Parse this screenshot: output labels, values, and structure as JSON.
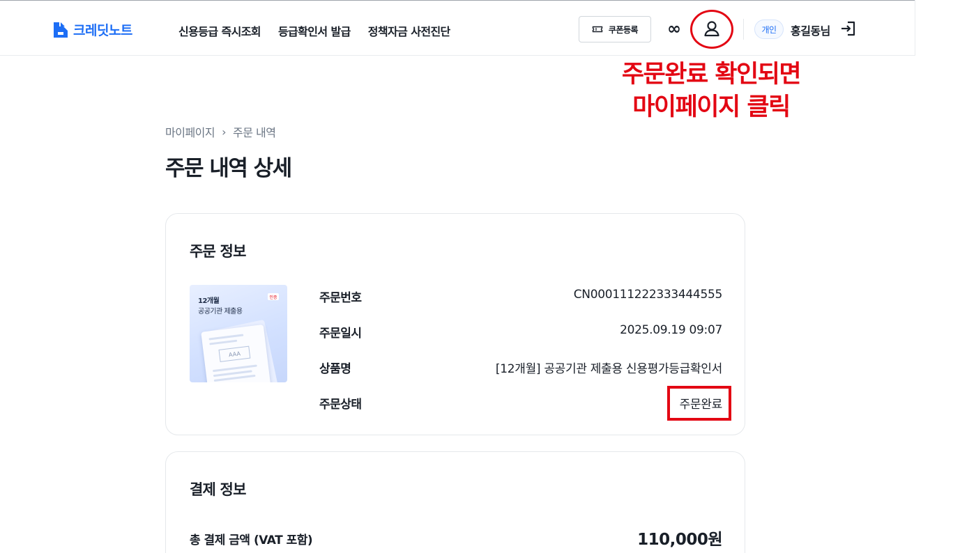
{
  "header": {
    "logo_text": "크레딧노트",
    "nav": [
      "신용등급 즉시조회",
      "등급확인서 발급",
      "정책자금 사전진단"
    ],
    "coupon_label": "쿠폰등록",
    "infinity_symbol": "∞",
    "account_type_badge": "개인",
    "username": "홍길동님"
  },
  "annotation": {
    "line1": "주문완료 확인되면",
    "line2": "마이페이지 클릭"
  },
  "breadcrumb": {
    "items": [
      "마이페이지",
      "주문 내역"
    ],
    "separator": "›"
  },
  "page_title": "주문 내역 상세",
  "order_info": {
    "title": "주문 정보",
    "thumbnail": {
      "line1": "12개월",
      "line2": "공공기관 제출용",
      "tag": "인증",
      "doc_label": "AAA"
    },
    "rows": [
      {
        "label": "주문번호",
        "value": "CN000111222333444555"
      },
      {
        "label": "주문일시",
        "value": "2025.09.19 09:07"
      },
      {
        "label": "상품명",
        "value": "[12개월] 공공기관 제출용 신용평가등급확인서"
      },
      {
        "label": "주문상태",
        "value": "주문완료"
      }
    ]
  },
  "payment_info": {
    "title": "결제 정보",
    "total_label": "총 결제 금액 (VAT 포함)",
    "total_value": "110,000원"
  },
  "colors": {
    "brand": "#1d6ef5",
    "annotation_red": "#e30613",
    "text": "#191f28",
    "muted": "#6b7684"
  }
}
